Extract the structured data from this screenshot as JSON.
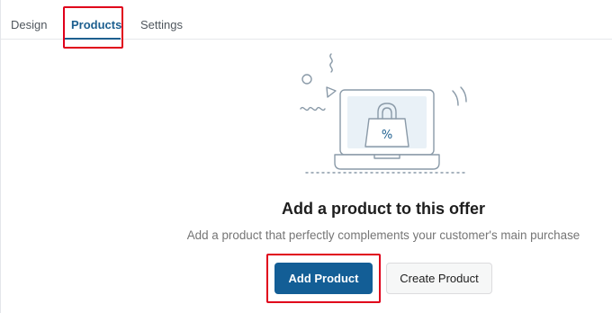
{
  "tabs": [
    {
      "label": "Design",
      "active": false
    },
    {
      "label": "Products",
      "active": true
    },
    {
      "label": "Settings",
      "active": false
    }
  ],
  "empty_state": {
    "illustration_icon": "laptop-shopping-bag-icon",
    "bag_symbol": "%",
    "heading": "Add a product to this offer",
    "description": "Add a product that perfectly complements your customer's main purchase"
  },
  "actions": {
    "add_product_label": "Add Product",
    "create_product_label": "Create Product"
  },
  "colors": {
    "accent": "#135e96",
    "tab_active": "#1d5f8f",
    "highlight": "#e0001b",
    "illustration_line": "#8a9aa8",
    "illustration_fill": "#e9f1f7"
  }
}
